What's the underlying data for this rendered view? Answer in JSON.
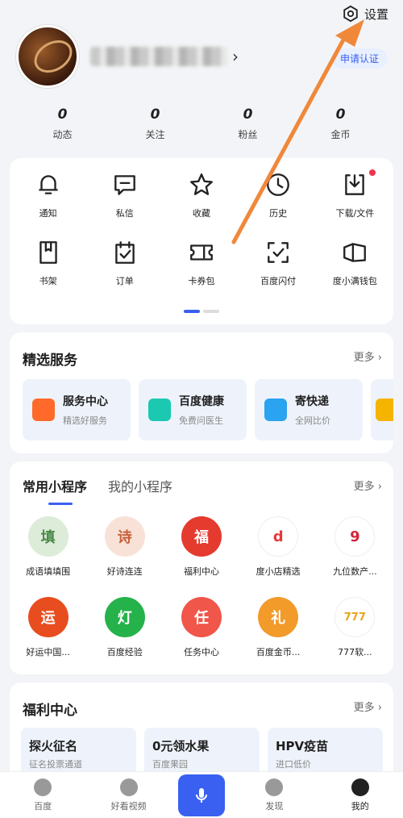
{
  "header": {
    "settings_label": "设置"
  },
  "profile": {
    "verify_label": "申请认证"
  },
  "stats": [
    {
      "value": "0",
      "label": "动态"
    },
    {
      "value": "0",
      "label": "关注"
    },
    {
      "value": "0",
      "label": "粉丝"
    },
    {
      "value": "0",
      "label": "金币"
    }
  ],
  "grid": [
    {
      "label": "通知",
      "icon": "bell-icon"
    },
    {
      "label": "私信",
      "icon": "message-icon"
    },
    {
      "label": "收藏",
      "icon": "star-icon"
    },
    {
      "label": "历史",
      "icon": "clock-icon"
    },
    {
      "label": "下载/文件",
      "icon": "download-icon"
    },
    {
      "label": "书架",
      "icon": "book-icon"
    },
    {
      "label": "订单",
      "icon": "order-icon"
    },
    {
      "label": "卡券包",
      "icon": "ticket-icon"
    },
    {
      "label": "百度闪付",
      "icon": "scan-pay-icon"
    },
    {
      "label": "度小满钱包",
      "icon": "wallet-icon"
    }
  ],
  "services": {
    "title": "精选服务",
    "more": "更多",
    "items": [
      {
        "title": "服务中心",
        "subtitle": "精选好服务",
        "color": "#ff6a2a"
      },
      {
        "title": "百度健康",
        "subtitle": "免费问医生",
        "color": "#1ac9b0"
      },
      {
        "title": "寄快递",
        "subtitle": "全网比价",
        "color": "#2aa3f0"
      }
    ]
  },
  "mini": {
    "tab_common": "常用小程序",
    "tab_mine": "我的小程序",
    "more": "更多",
    "apps": [
      {
        "label": "成语填填围",
        "glyph": "填",
        "color": "#6aa96a"
      },
      {
        "label": "好诗连连",
        "glyph": "诗",
        "color": "#d9826a"
      },
      {
        "label": "福利中心",
        "glyph": "福",
        "color": "#e53a2e"
      },
      {
        "label": "度小店精选",
        "glyph": "d",
        "color": "#e33a3a"
      },
      {
        "label": "九位数产...",
        "glyph": "9",
        "color": "#d0263a"
      },
      {
        "label": "好运中国...",
        "glyph": "运",
        "color": "#e84d1f"
      },
      {
        "label": "百度经验",
        "glyph": "灯",
        "color": "#26b24a"
      },
      {
        "label": "任务中心",
        "glyph": "任",
        "color": "#f0564a"
      },
      {
        "label": "百度金币...",
        "glyph": "礼",
        "color": "#f29a2a"
      },
      {
        "label": "777软...",
        "glyph": "777",
        "color": "#e8a41a"
      }
    ]
  },
  "welfare": {
    "title": "福利中心",
    "more": "更多",
    "items": [
      {
        "title": "探火征名",
        "subtitle": "征名投票通道"
      },
      {
        "title": "0元领水果",
        "subtitle": "百度果园"
      },
      {
        "title": "HPV疫苗",
        "subtitle": "进口低价"
      }
    ]
  },
  "nav": [
    {
      "label": "百度"
    },
    {
      "label": "好看视频"
    },
    {
      "label": "发现"
    },
    {
      "label": "我的"
    }
  ]
}
